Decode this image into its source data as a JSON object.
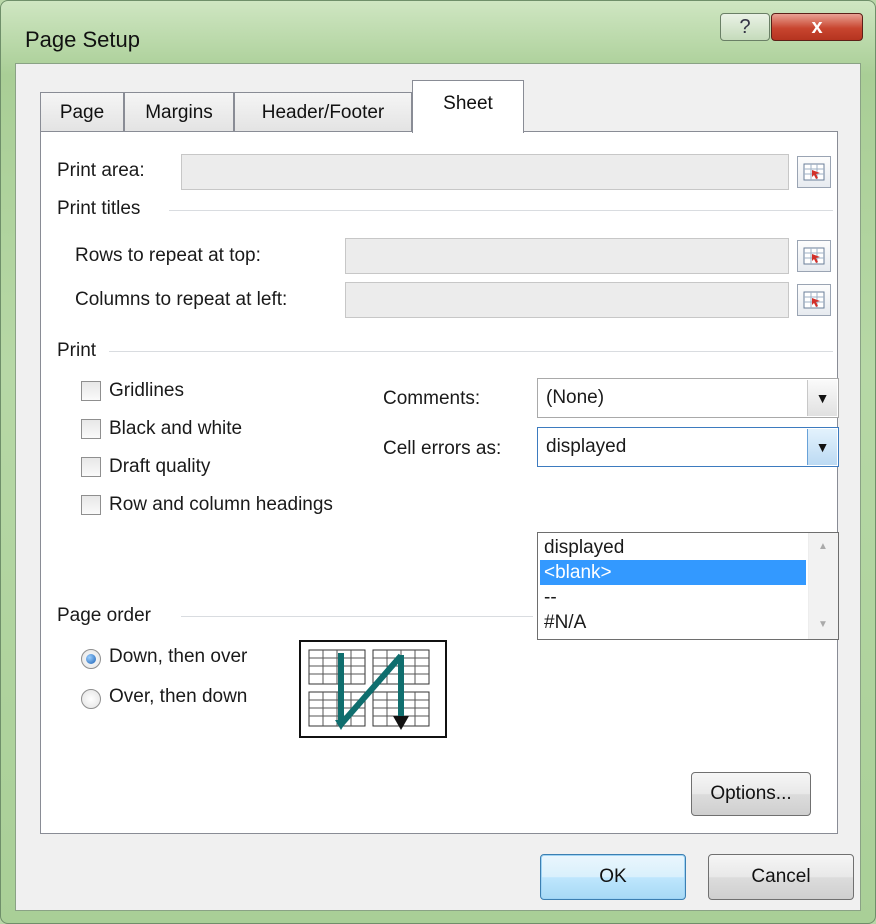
{
  "window": {
    "title": "Page Setup",
    "help_label": "?",
    "close_label": "x"
  },
  "tabs": [
    {
      "label": "Page"
    },
    {
      "label": "Margins"
    },
    {
      "label": "Header/Footer"
    },
    {
      "label": "Sheet",
      "active": true
    }
  ],
  "sheet": {
    "print_area_label": "Print area:",
    "print_area_value": "",
    "print_titles_label": "Print titles",
    "rows_repeat_label": "Rows to repeat at top:",
    "rows_repeat_value": "",
    "cols_repeat_label": "Columns to repeat at left:",
    "cols_repeat_value": ""
  },
  "print": {
    "group_label": "Print",
    "checkboxes": [
      {
        "label": "Gridlines",
        "checked": false
      },
      {
        "label": "Black and white",
        "checked": false
      },
      {
        "label": "Draft quality",
        "checked": false
      },
      {
        "label": "Row and column headings",
        "checked": false
      }
    ],
    "comments_label": "Comments:",
    "comments_value": "(None)",
    "cell_errors_label": "Cell errors as:",
    "cell_errors_value": "displayed",
    "cell_errors_options": [
      "displayed",
      "<blank>",
      "--",
      "#N/A"
    ],
    "cell_errors_highlighted": "<blank>"
  },
  "page_order": {
    "group_label": "Page order",
    "options": [
      {
        "label": "Down, then over",
        "checked": true
      },
      {
        "label": "Over, then down",
        "checked": false
      }
    ]
  },
  "buttons": {
    "options": "Options...",
    "ok": "OK",
    "cancel": "Cancel"
  },
  "colors": {
    "accent": "#3399ff",
    "arrow": "#0f6e6e",
    "close": "#c8452f"
  }
}
